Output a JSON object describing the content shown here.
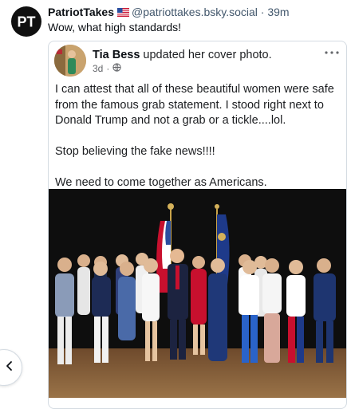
{
  "post": {
    "author_initials": "PT",
    "author_name": "PatriotTakes",
    "author_flag": "us-flag-icon",
    "handle": "@patriottakes.bsky.social",
    "separator": "·",
    "age": "39m",
    "text": "Wow, what high standards!"
  },
  "embed": {
    "name": "Tia Bess",
    "action": "updated her cover photo.",
    "time": "3d",
    "separator": "·",
    "privacy_icon": "globe-icon",
    "more_icon": "more-icon",
    "body": [
      "I can attest that all of these beautiful women were safe from the famous grab statement. I stood right next to Donald Trump and not a grab or a tickle....lol.",
      "Stop believing the fake news!!!!",
      "We need to come together as Americans."
    ],
    "photo_icon": "group-photo"
  },
  "nav": {
    "back_icon": "chevron-left-icon"
  },
  "colors": {
    "text": "#0b0f14",
    "muted": "#42576c",
    "border": "#d4dbe2",
    "backdrop": "#111111"
  }
}
